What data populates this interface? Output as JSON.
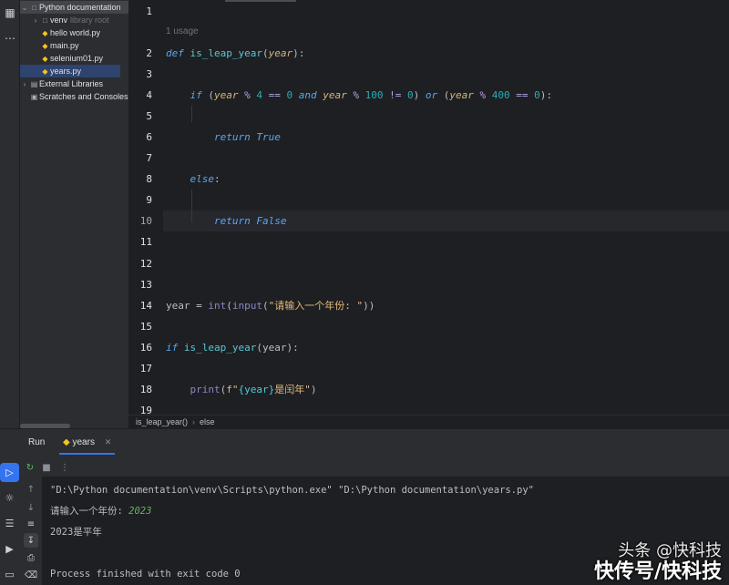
{
  "project": {
    "root": "Python documentation",
    "items": [
      {
        "label": "venv",
        "hint": "library root",
        "type": "folder"
      },
      {
        "label": "hello world.py",
        "type": "py"
      },
      {
        "label": "main.py",
        "type": "py"
      },
      {
        "label": "selenium01.py",
        "type": "py"
      },
      {
        "label": "years.py",
        "type": "py"
      },
      {
        "label": "External Libraries",
        "type": "lib"
      },
      {
        "label": "Scratches and Consoles",
        "type": "scratch"
      }
    ]
  },
  "editor": {
    "usage_hint": "1 usage",
    "current_line": 10,
    "line_numbers": [
      "1",
      "2",
      "3",
      "4",
      "5",
      "6",
      "7",
      "8",
      "9",
      "10",
      "11",
      "12",
      "13",
      "14",
      "15",
      "16",
      "17",
      "18",
      "19"
    ],
    "code": {
      "l2_def": "def",
      "l2_fn": "is_leap_year",
      "l2_param": "year",
      "l4_if": "if",
      "l4_year1": "year",
      "l4_mod1": "%",
      "l4_n4": "4",
      "l4_eq1": "==",
      "l4_n0a": "0",
      "l4_and": "and",
      "l4_year2": "year",
      "l4_mod2": "%",
      "l4_n100": "100",
      "l4_neq": "!=",
      "l4_n0b": "0",
      "l4_or": "or",
      "l4_year3": "year",
      "l4_mod3": "%",
      "l4_n400": "400",
      "l4_eq2": "==",
      "l4_n0c": "0",
      "l6_return": "return",
      "l6_true": "True",
      "l8_else": "else",
      "l10_return": "return",
      "l10_false": "False",
      "l14_var": "year",
      "l14_eq": "=",
      "l14_int": "int",
      "l14_input": "input",
      "l14_str": "\"请输入一个年份: \"",
      "l16_if": "if",
      "l16_call": "is_leap_year",
      "l16_arg": "year",
      "l18_print": "print",
      "l18_fpre": "f\"",
      "l18_var": "{year}",
      "l18_rest": "是闰年\""
    }
  },
  "breadcrumb": [
    "is_leap_year()",
    "else"
  ],
  "run": {
    "title": "Run",
    "tab_label": "years",
    "console": [
      "\"D:\\Python documentation\\venv\\Scripts\\python.exe\" \"D:\\Python documentation\\years.py\"",
      "请输入一个年份: ",
      "2023是平年",
      "Process finished with exit code 0"
    ],
    "console_input": "2023"
  },
  "watermark": {
    "line1": "头条 @快科技",
    "line2": "快传号/快科技"
  },
  "colors": {
    "accent": "#3574f0",
    "keyword": "#cf8e6d",
    "function": "#56c8d8",
    "number": "#2aacb8"
  }
}
